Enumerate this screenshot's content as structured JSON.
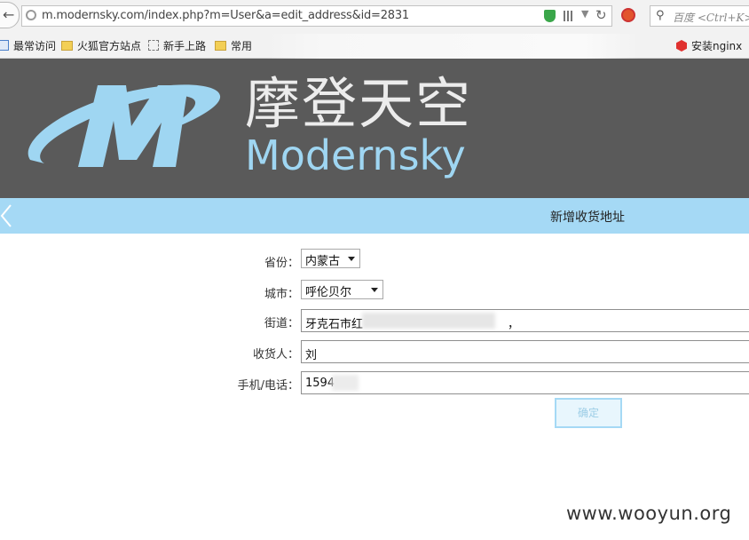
{
  "browser": {
    "url": "m.modernsky.com/index.php?m=User&a=edit_address&id=2831",
    "search_placeholder": "百度 <Ctrl+K>",
    "bookmarks": [
      "最常访问",
      "火狐官方站点",
      "新手上路",
      "常用",
      "安装nginx"
    ]
  },
  "site": {
    "brand_cn": "摩登天空",
    "brand_en": "Modernsky",
    "logo_color": "#9fd6f2",
    "header_bg": "#5a5a5a"
  },
  "titlebar": {
    "title": "新增收货地址",
    "bg": "#a5d9f5"
  },
  "form": {
    "province_label": "省份：",
    "province_value": "内蒙古",
    "city_label": "城市：",
    "city_value": "呼伦贝尔",
    "street_label": "街道：",
    "street_value": "牙克石市红",
    "street_suffix": "，",
    "receiver_label": "收货人：",
    "receiver_value": "刘",
    "phone_label": "手机/电话：",
    "phone_value": "1594",
    "submit_label": "确定"
  },
  "watermark": "www.wooyun.org"
}
